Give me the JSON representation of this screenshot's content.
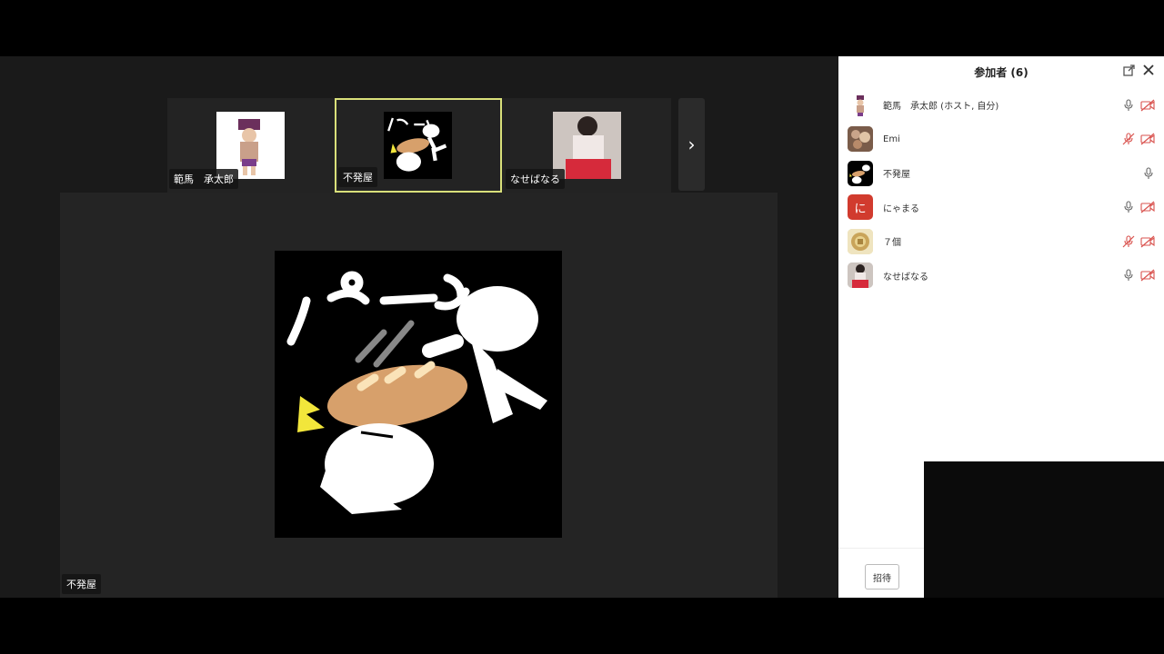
{
  "main_video": {
    "name": "不発屋"
  },
  "thumbnails": [
    {
      "name": "範馬　承太郎"
    },
    {
      "name": "不発屋",
      "active": true
    },
    {
      "name": "なせばなる"
    }
  ],
  "panel": {
    "title": "参加者 (6)",
    "participants": [
      {
        "name": "範馬　承太郎 (ホスト, 自分)",
        "mic": "on",
        "video": "off"
      },
      {
        "name": "Emi",
        "mic": "off",
        "video": "off"
      },
      {
        "name": "不発屋",
        "mic": "on",
        "video": "none"
      },
      {
        "name": "にゃまる",
        "avatar_text": "に",
        "mic": "on",
        "video": "off"
      },
      {
        "name": "７個",
        "mic": "off",
        "video": "off"
      },
      {
        "name": "なせばなる",
        "mic": "on",
        "video": "off"
      }
    ],
    "invite_label": "招待"
  },
  "colors": {
    "active_border": "#d9e07a",
    "muted_red": "#d9534f",
    "avatar_red": "#d13b2e"
  }
}
